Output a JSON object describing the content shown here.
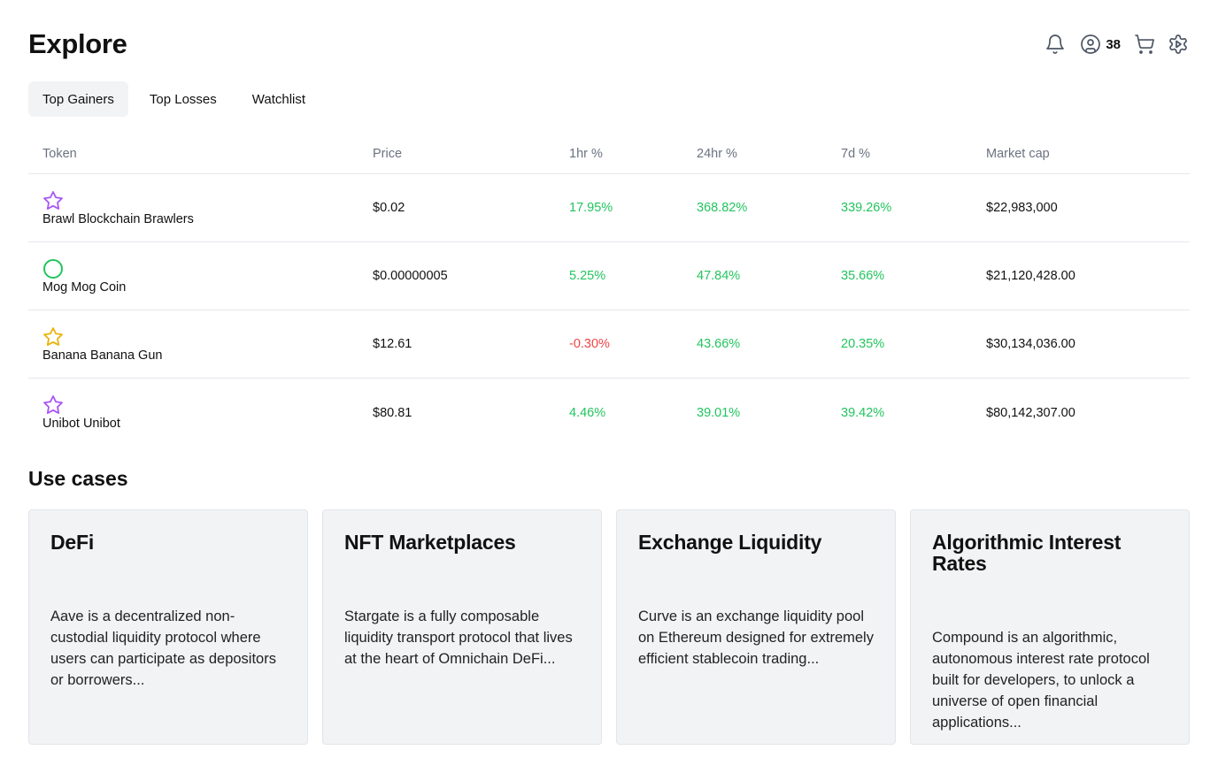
{
  "header": {
    "title": "Explore",
    "account_count": "38"
  },
  "tabs": [
    {
      "label": "Top Gainers",
      "active": true
    },
    {
      "label": "Top Losses",
      "active": false
    },
    {
      "label": "Watchlist",
      "active": false
    }
  ],
  "table": {
    "columns": [
      "Token",
      "Price",
      "1hr %",
      "24hr %",
      "7d %",
      "Market cap"
    ],
    "rows": [
      {
        "icon": "star-icon",
        "icon_color": "#a855f7",
        "name": "Brawl Blockchain Brawlers",
        "price": "$0.02",
        "h1": "17.95%",
        "h24": "368.82%",
        "d7": "339.26%",
        "cap": "$22,983,000"
      },
      {
        "icon": "circle-icon",
        "icon_color": "#22c55e",
        "name": "Mog Mog Coin",
        "price": "$0.00000005",
        "h1": "5.25%",
        "h24": "47.84%",
        "d7": "35.66%",
        "cap": "$21,120,428.00"
      },
      {
        "icon": "star-icon",
        "icon_color": "#eab308",
        "name": "Banana Banana Gun",
        "price": "$12.61",
        "h1": "-0.30%",
        "h24": "43.66%",
        "d7": "20.35%",
        "cap": "$30,134,036.00"
      },
      {
        "icon": "star-icon",
        "icon_color": "#a855f7",
        "name": "Unibot Unibot",
        "price": "$80.81",
        "h1": "4.46%",
        "h24": "39.01%",
        "d7": "39.42%",
        "cap": "$80,142,307.00"
      }
    ]
  },
  "use_cases": {
    "title": "Use cases",
    "cards": [
      {
        "title": "DeFi",
        "description": "Aave is a decentralized non-custodial liquidity protocol where users can participate as depositors or borrowers..."
      },
      {
        "title": "NFT Marketplaces",
        "description": "Stargate is a fully composable liquidity transport protocol that lives at the heart of Omnichain DeFi..."
      },
      {
        "title": "Exchange Liquidity",
        "description": "Curve is an exchange liquidity pool on Ethereum designed for extremely efficient stablecoin trading..."
      },
      {
        "title": "Algorithmic Interest Rates",
        "description": "Compound is an algorithmic, autonomous interest rate protocol built for developers, to unlock a universe of open financial applications..."
      }
    ]
  },
  "colors": {
    "positive": "#22c55e",
    "negative": "#ef4444",
    "tab_active_bg": "#f2f3f5",
    "card_bg": "#f2f3f5"
  }
}
